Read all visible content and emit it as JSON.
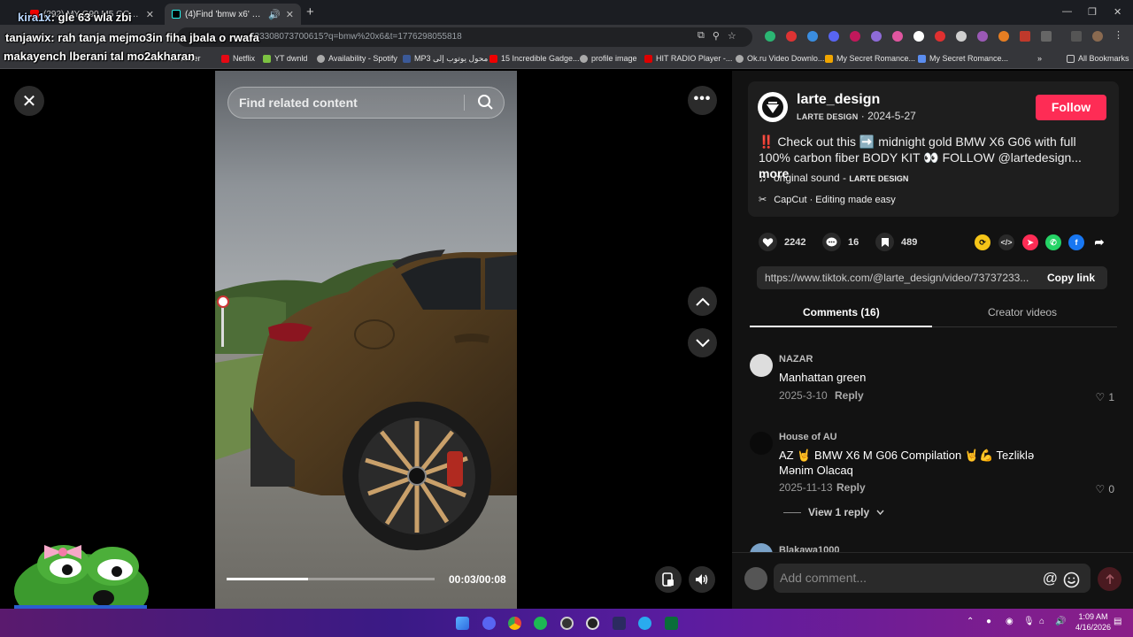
{
  "browser": {
    "tabs": [
      {
        "title": "(292) MY G90 M5 GOT STOLEN",
        "active": false
      },
      {
        "title": "(4)Find 'bmw x6' on TikTok",
        "active": true
      }
    ],
    "url": "723308073700615?q=bmw%20x6&t=1776298055818",
    "bookmarks": [
      "ew folder",
      "Netflix",
      "YT dwnld",
      "Availability - Spotify",
      "MP3 محول يوتوب إلى",
      "15 Incredible Gadge...",
      "profile image",
      "HIT RADIO Player -...",
      "Ok.ru Video Downlo...",
      "My Secret Romance...",
      "My Secret Romance..."
    ],
    "all_bookmarks": "All Bookmarks"
  },
  "overlay": {
    "line1_name": "kira1x",
    "line1_text": ": gle 63 wla zbi",
    "line2_name": "tanjawix",
    "line2_text": ": rah tanja mejmo3in fiha jbala o rwafa",
    "line3_text": "makayench lberani tal mo2akharan"
  },
  "player": {
    "search_placeholder": "Find related content",
    "timecode": "00:03/00:08",
    "progress": 0.39
  },
  "post": {
    "username": "larte_design",
    "display_name": "LARTE DESIGN",
    "date": "2024-5-27",
    "follow_label": "Follow",
    "description_prefix": "‼️ Check out this ➡️ midnight gold BMW X6 G06 with full 100% carbon fiber BODY KIT 👀 FOLLOW @lartedesign...",
    "more_label": "more",
    "sound_label": "original sound - ",
    "sound_artist": "LARTE DESIGN",
    "capcut": "CapCut · Editing made easy",
    "likes": "2242",
    "comments_count": "16",
    "saves": "489",
    "link": "https://www.tiktok.com/@larte_design/video/73737233...",
    "copy_label": "Copy link"
  },
  "tabs": {
    "comments": "Comments (16)",
    "creator": "Creator videos"
  },
  "comments": [
    {
      "author": "NAZAR",
      "text": "Manhattan green",
      "date": "2025-3-10",
      "reply": "Reply",
      "likes": "1"
    },
    {
      "author": "House of AU",
      "text": "AZ 🤘 BMW X6 M G06 Compilation 🤘💪 Tezliklə Mənim Olacaq",
      "date": "2025-11-13",
      "reply": "Reply",
      "likes": "0",
      "view_replies": "View 1 reply"
    },
    {
      "author": "Blakawa1000"
    }
  ],
  "comment_input": {
    "placeholder": "Add comment...",
    "at_symbol": "@"
  },
  "taskbar": {
    "time": "1:09 AM",
    "date": "4/16/2026"
  }
}
